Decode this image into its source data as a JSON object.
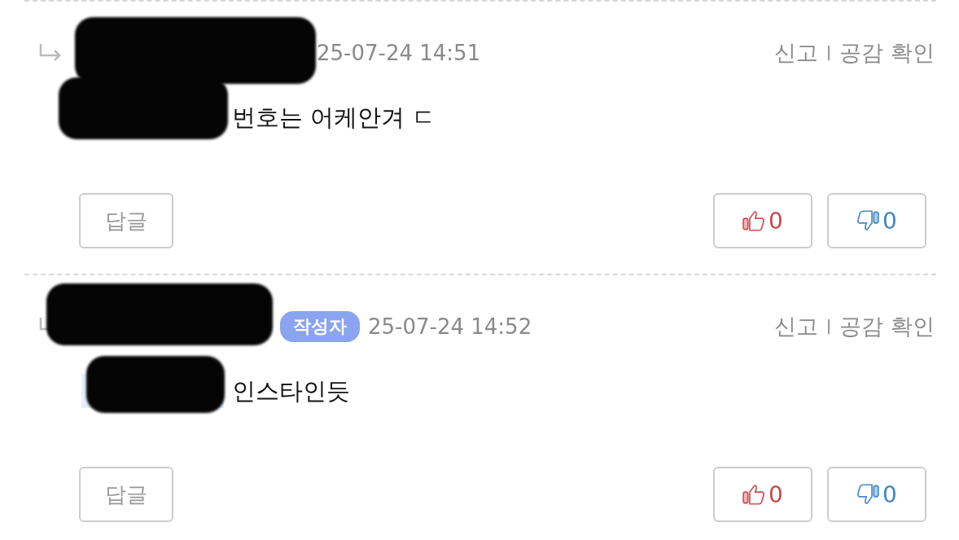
{
  "comments": [
    {
      "is_reply": true,
      "author_redacted": true,
      "date": "25-07-24 14:51",
      "actions": [
        "신고",
        "공감 확인"
      ],
      "mention_highlight": false,
      "text": "번호는 어케안겨 ㄷ",
      "reply_button": "답글",
      "likes": "0",
      "dislikes": "0"
    },
    {
      "is_reply": true,
      "author_redacted": true,
      "badge": "작성자",
      "date": "25-07-24 14:52",
      "actions": [
        "신고",
        "공감 확인"
      ],
      "mention_highlight": true,
      "text": "인스타인듯",
      "reply_button": "답글",
      "likes": "0",
      "dislikes": "0"
    }
  ]
}
